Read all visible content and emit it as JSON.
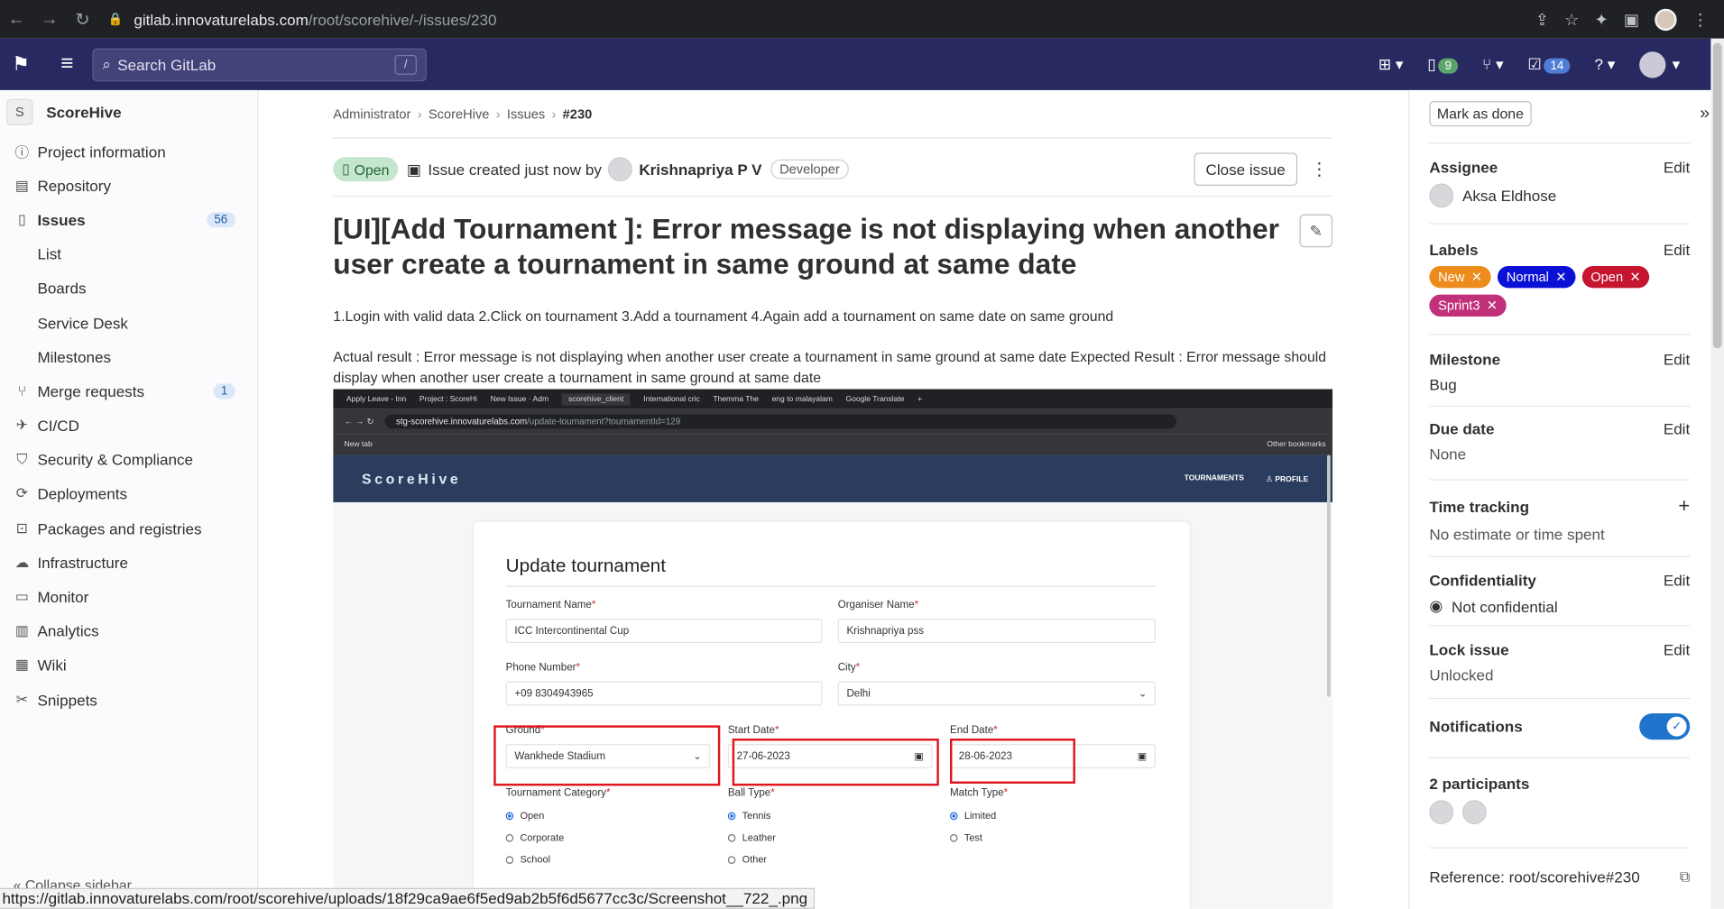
{
  "browser": {
    "url_host": "gitlab.innovaturelabs.com",
    "url_path": "/root/scorehive/-/issues/230"
  },
  "topnav": {
    "search_placeholder": "Search GitLab",
    "search_shortcut": "/",
    "issues_count": "9",
    "todos_count": "14"
  },
  "sidebar": {
    "project_initial": "S",
    "project_name": "ScoreHive",
    "items": [
      {
        "label": "Project information",
        "icon": "info-icon"
      },
      {
        "label": "Repository",
        "icon": "book-icon"
      },
      {
        "label": "Issues",
        "icon": "issues-icon",
        "count": "56"
      },
      {
        "label": "List"
      },
      {
        "label": "Boards"
      },
      {
        "label": "Service Desk"
      },
      {
        "label": "Milestones"
      },
      {
        "label": "Merge requests",
        "icon": "merge-request-icon",
        "count": "1"
      },
      {
        "label": "CI/CD",
        "icon": "rocket-icon"
      },
      {
        "label": "Security & Compliance",
        "icon": "shield-icon"
      },
      {
        "label": "Deployments",
        "icon": "deployments-icon"
      },
      {
        "label": "Packages and registries",
        "icon": "package-icon"
      },
      {
        "label": "Infrastructure",
        "icon": "cloud-icon"
      },
      {
        "label": "Monitor",
        "icon": "monitor-icon"
      },
      {
        "label": "Analytics",
        "icon": "chart-icon"
      },
      {
        "label": "Wiki",
        "icon": "wiki-icon"
      },
      {
        "label": "Snippets",
        "icon": "snippet-icon"
      }
    ],
    "collapse_label": "Collapse sidebar"
  },
  "breadcrumb": [
    "Administrator",
    "ScoreHive",
    "Issues",
    "#230"
  ],
  "issue": {
    "status": "Open",
    "created_text": "Issue created just now by",
    "author": "Krishnapriya P V",
    "role": "Developer",
    "close_label": "Close issue",
    "title": "[UI][Add Tournament ]: Error message is not displaying when another user create a tournament in same ground at same date",
    "steps": "1.Login with valid data 2.Click on tournament 3.Add a tournament 4.Again add a tournament on same date on same ground",
    "result": "Actual result : Error message is not displaying when another user create a tournament in same ground at same date Expected Result : Error message should display when another user create a tournament in same ground at same date"
  },
  "screenshot": {
    "tabs": [
      "Apply Leave - Inn",
      "Project : ScoreHi",
      "New Issue · Adm",
      "scorehive_client",
      "International cric",
      "Themma The",
      "eng to malayalam",
      "Google Translate"
    ],
    "url_host": "stg-scorehive.innovaturelabs.com",
    "url_path": "/update-tournament?tournamentId=129",
    "bookmark": "New tab",
    "other_bookmarks": "Other bookmarks",
    "brand": "ScoreHive",
    "menu_tournaments": "TOURNAMENTS",
    "menu_profile": "PROFILE",
    "form_title": "Update tournament",
    "tournament_name_label": "Tournament Name",
    "tournament_name_value": "ICC Intercontinental Cup",
    "organiser_label": "Organiser Name",
    "organiser_value": "Krishnapriya pss",
    "phone_label": "Phone Number",
    "phone_value": "+09 8304943965",
    "city_label": "City",
    "city_value": "Delhi",
    "ground_label": "Ground",
    "ground_value": "Wankhede Stadium",
    "start_label": "Start Date",
    "start_value": "27-06-2023",
    "end_label": "End Date",
    "end_value": "28-06-2023",
    "category_label": "Tournament Category",
    "category_options": [
      "Open",
      "Corporate",
      "School"
    ],
    "ball_label": "Ball Type",
    "ball_options": [
      "Tennis",
      "Leather",
      "Other"
    ],
    "match_label": "Match Type",
    "match_options": [
      "Limited",
      "Test"
    ]
  },
  "right_sidebar": {
    "mark_done": "Mark as done",
    "edit": "Edit",
    "assignee_title": "Assignee",
    "assignee": "Aksa Eldhose",
    "labels_title": "Labels",
    "labels": [
      {
        "text": "New",
        "color": "#ed8b1c"
      },
      {
        "text": "Normal",
        "color": "#0b10d6"
      },
      {
        "text": "Open",
        "color": "#c5152f"
      },
      {
        "text": "Sprint3",
        "color": "#c1307b"
      }
    ],
    "milestone_title": "Milestone",
    "milestone": "Bug",
    "due_title": "Due date",
    "due": "None",
    "time_title": "Time tracking",
    "time": "No estimate or time spent",
    "conf_title": "Confidentiality",
    "conf": "Not confidential",
    "lock_title": "Lock issue",
    "lock": "Unlocked",
    "notif_title": "Notifications",
    "participants_title": "2 participants",
    "reference": "Reference: root/scorehive#230"
  },
  "status_url": "https://gitlab.innovaturelabs.com/root/scorehive/uploads/18f29ca9ae6f5ed9ab2b5f6d5677cc3c/Screenshot__722_.png"
}
